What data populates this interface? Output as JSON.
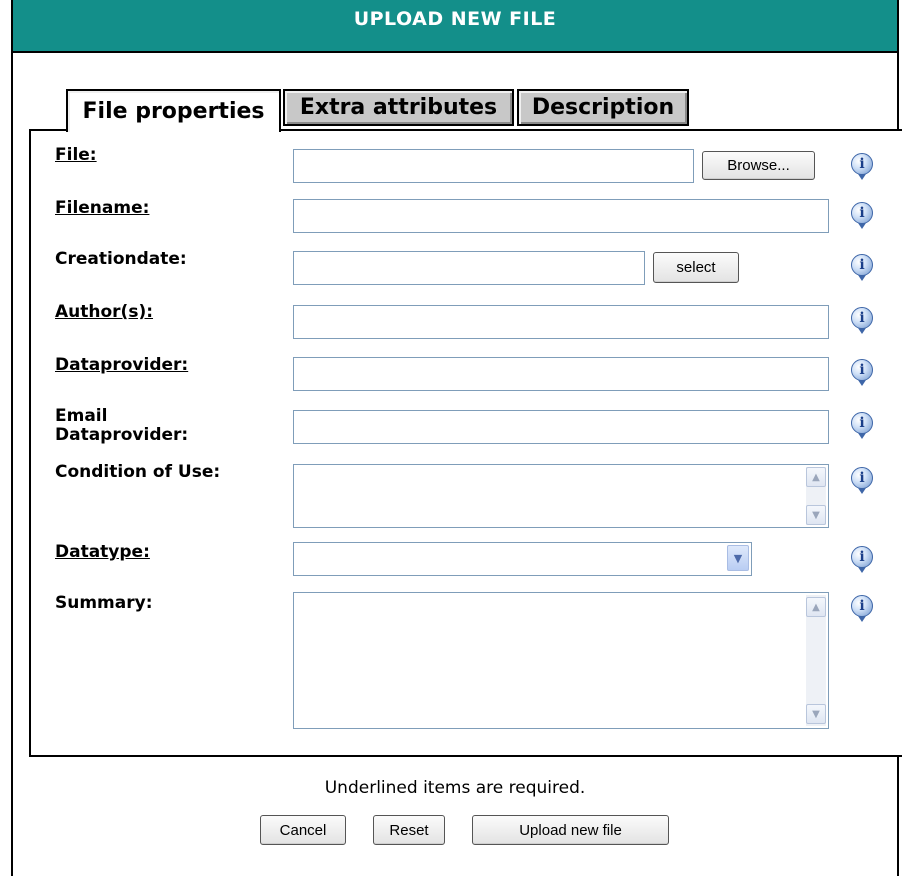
{
  "window": {
    "title": "UPLOAD NEW FILE"
  },
  "tabs": [
    {
      "label": "File properties",
      "active": true
    },
    {
      "label": "Extra attributes",
      "active": false
    },
    {
      "label": "Description",
      "active": false
    }
  ],
  "form": {
    "file": {
      "label": "File:",
      "value": "",
      "browse_label": "Browse..."
    },
    "filename": {
      "label": "Filename:",
      "value": ""
    },
    "creationdate": {
      "label": "Creationdate:",
      "value": "",
      "select_label": "select"
    },
    "authors": {
      "label": "Author(s):",
      "value": ""
    },
    "dataprovider": {
      "label": "Dataprovider:",
      "value": ""
    },
    "email_dataprovider": {
      "label_line1": "Email",
      "label_line2": "Dataprovider:",
      "value": ""
    },
    "condition_of_use": {
      "label": "Condition of Use:",
      "value": ""
    },
    "datatype": {
      "label": "Datatype:",
      "selected": ""
    },
    "summary": {
      "label": "Summary:",
      "value": ""
    }
  },
  "info_icon_glyph": "i",
  "footer": {
    "note": "Underlined items are required.",
    "cancel_label": "Cancel",
    "reset_label": "Reset",
    "upload_label": "Upload new file"
  },
  "colors": {
    "titlebar": "#138f8a",
    "highlight_ellipse": "#d42a2a",
    "field_border": "#7f9db9"
  }
}
